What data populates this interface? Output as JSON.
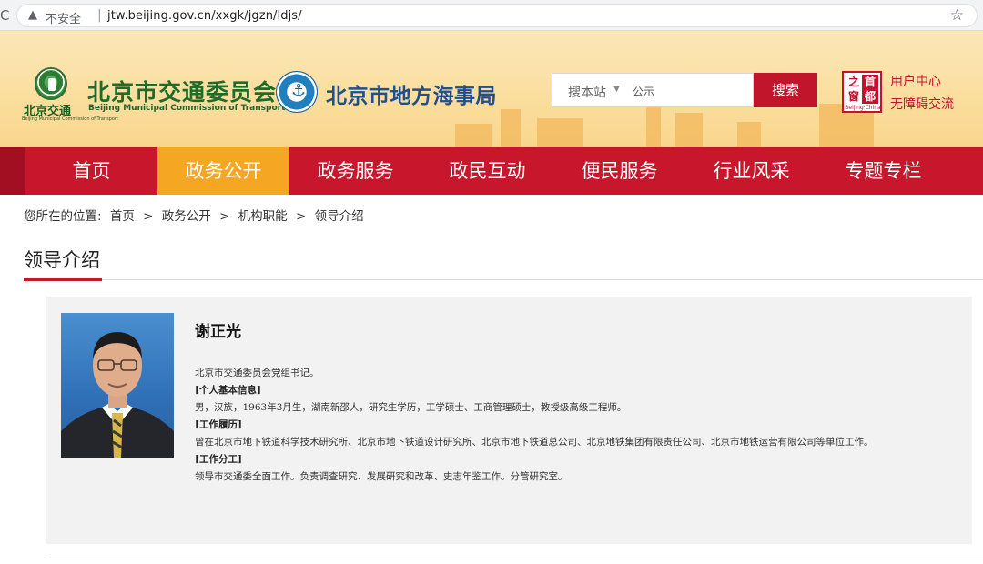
{
  "browser": {
    "reload_glyph": "C",
    "security_label": "不安全",
    "url": "jtw.beijing.gov.cn/xxgk/jgzn/ldjs/"
  },
  "header": {
    "emblem_short_name": "北京交通",
    "emblem_tiny_en": "Beijing Municipal Commission of Transport",
    "org_title": "北京市交通委员会",
    "org_english": "Beijing Municipal Commission of Transport",
    "msa_title": "北京市地方海事局",
    "search": {
      "scope": "搜本站",
      "value": "公示",
      "button": "搜索"
    },
    "seal_chars": [
      "之",
      "首",
      "窗",
      "都"
    ],
    "seal_foot": "Beijing·China",
    "user_center": "用户中心",
    "accessible": "无障碍交流"
  },
  "nav": {
    "items": [
      "首页",
      "政务公开",
      "政务服务",
      "政民互动",
      "便民服务",
      "行业风采",
      "专题专栏"
    ],
    "active_index": 1,
    "colors": {
      "band": "#c8172c",
      "active": "#f5a623"
    }
  },
  "breadcrumb": {
    "prefix": "您所在的位置:",
    "items": [
      "首页",
      "政务公开",
      "机构职能",
      "领导介绍"
    ],
    "separator": ">"
  },
  "section": {
    "title": "领导介绍"
  },
  "leader": {
    "name": "谢正光",
    "position": "北京市交通委员会党组书记。",
    "basic_info_label": "[个人基本信息]",
    "basic_info": "男，汉族，1963年3月生，湖南新邵人，研究生学历，工学硕士、工商管理硕士，教授级高级工程师。",
    "career_label": "[工作履历]",
    "career": "曾在北京市地下铁道科学技术研究所、北京市地下铁道设计研究所、北京市地下铁道总公司、北京地铁集团有限责任公司、北京市地铁运营有限公司等单位工作。",
    "duties_label": "[工作分工]",
    "duties": "领导市交通委全面工作。负责调查研究、发展研究和改革、史志年鉴工作。分管研究室。"
  }
}
